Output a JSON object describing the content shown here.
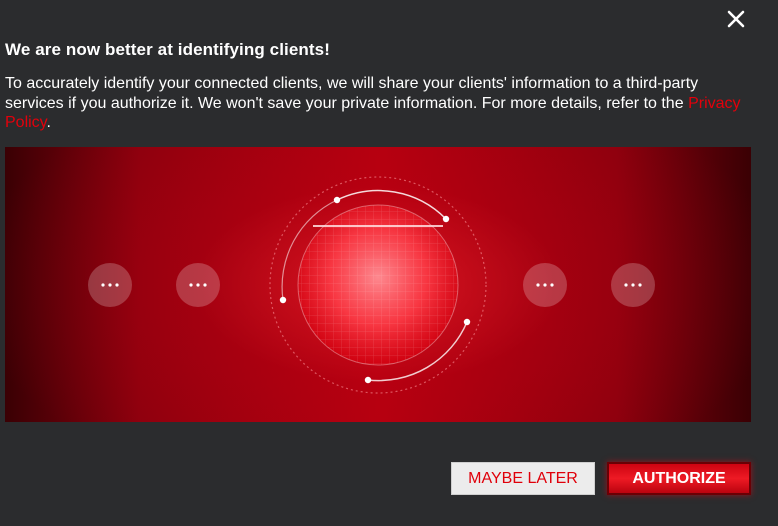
{
  "dialog": {
    "close_label": "×",
    "title": "We are now better at identifying clients!",
    "description": "To accurately identify your connected clients, we will share your clients' information to a third-party services if you authorize it. We won't save your private information. For more details, refer to the",
    "privacy_link": "Privacy Policy",
    "period": "."
  },
  "banner": {
    "device_icons": [
      "more-dots-icon",
      "more-dots-icon",
      "more-dots-icon",
      "more-dots-icon"
    ],
    "center_icon": "globe-icon"
  },
  "actions": {
    "maybe_later": "MAYBE LATER",
    "authorize": "AUTHORIZE"
  },
  "colors": {
    "background": "#2b2c2e",
    "accent": "#e3000b",
    "text": "#ffffff"
  }
}
